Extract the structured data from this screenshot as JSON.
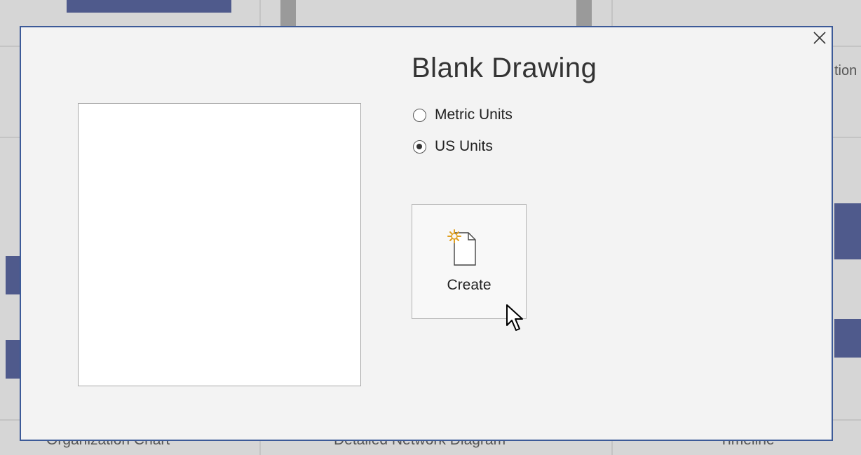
{
  "background": {
    "labels": [
      "Organization Chart",
      "Detailed Network Diagram",
      "Timeline"
    ],
    "right_partial_text": "tion"
  },
  "dialog": {
    "title": "Blank Drawing",
    "units": [
      {
        "label": "Metric Units",
        "checked": false
      },
      {
        "label": "US Units",
        "checked": true
      }
    ],
    "create_label": "Create",
    "close_icon": "close-icon",
    "accent_color": "#3c5a98"
  }
}
